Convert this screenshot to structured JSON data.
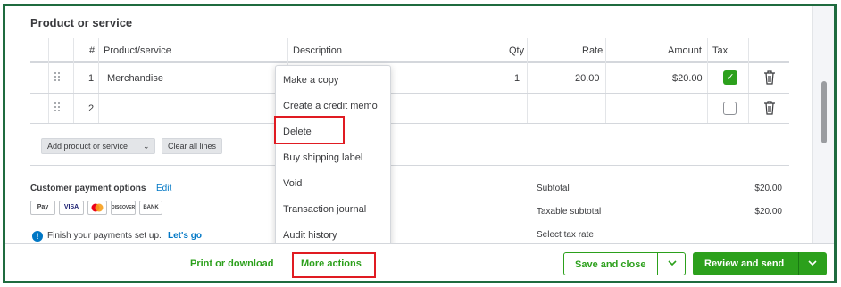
{
  "section": {
    "title": "Product or service"
  },
  "table": {
    "headers": {
      "num": "#",
      "product": "Product/service",
      "description": "Description",
      "qty": "Qty",
      "rate": "Rate",
      "amount": "Amount",
      "tax": "Tax"
    },
    "rows": [
      {
        "num": "1",
        "product": "Merchandise",
        "qty": "1",
        "rate": "20.00",
        "amount": "$20.00",
        "tax_checked": true
      },
      {
        "num": "2",
        "product": "",
        "qty": "",
        "rate": "",
        "amount": "",
        "tax_checked": false
      }
    ],
    "buttons": {
      "add": "Add product or service",
      "clear": "Clear all lines"
    }
  },
  "menu": {
    "items": [
      "Make a copy",
      "Create a credit memo",
      "Delete",
      "Buy shipping label",
      "Void",
      "Transaction journal",
      "Audit history"
    ]
  },
  "payments": {
    "title": "Customer payment options",
    "edit": "Edit",
    "cards": [
      "Pay",
      "VISA",
      "DISCOVER",
      "BANK"
    ],
    "finish_text": "Finish your payments set up.",
    "lets_go": "Let's go"
  },
  "summary": {
    "subtotal_label": "Subtotal",
    "subtotal_value": "$20.00",
    "taxable_label": "Taxable subtotal",
    "taxable_value": "$20.00",
    "tax_rate_label": "Select tax rate"
  },
  "footer": {
    "print": "Print or download",
    "more": "More actions",
    "save": "Save and close",
    "send": "Review and send"
  },
  "colors": {
    "accent_green": "#2ca01c",
    "link_blue": "#0077c5",
    "highlight_red": "#e01b22",
    "frame_green": "#1f6b3f"
  }
}
